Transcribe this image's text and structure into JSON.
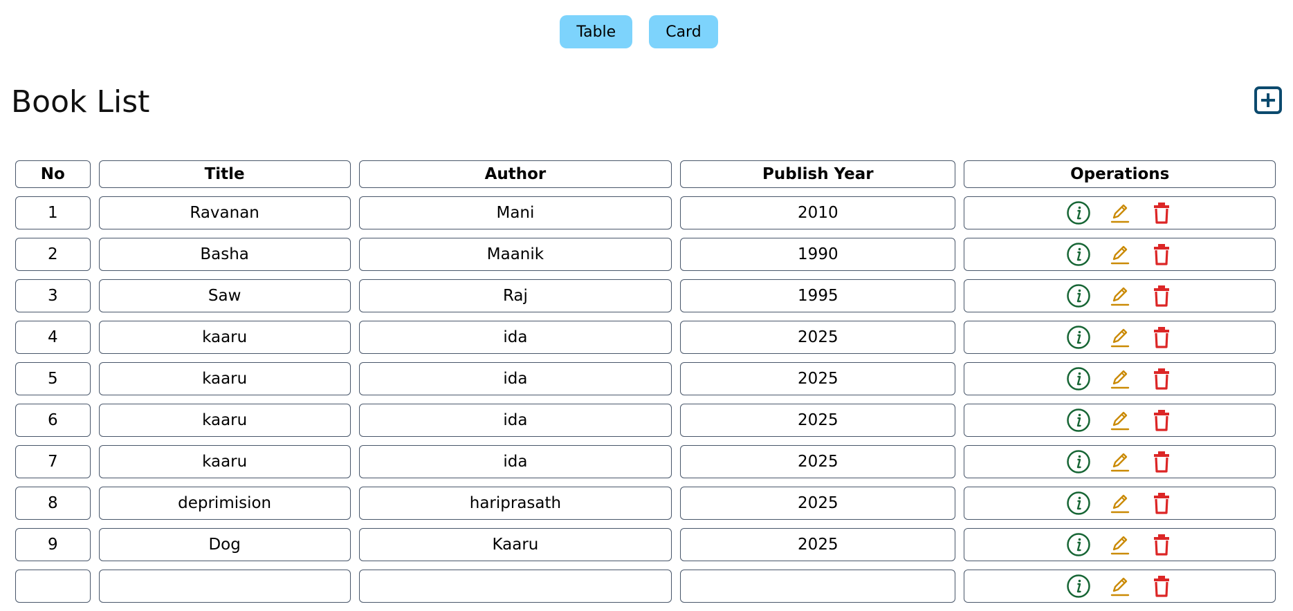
{
  "view_toggle": {
    "table_label": "Table",
    "card_label": "Card"
  },
  "page": {
    "title": "Book List",
    "add_icon": "plus-square-icon"
  },
  "table": {
    "headers": [
      "No",
      "Title",
      "Author",
      "Publish Year",
      "Operations"
    ],
    "rows": [
      {
        "no": "1",
        "title": "Ravanan",
        "author": "Mani",
        "year": "2010"
      },
      {
        "no": "2",
        "title": "Basha",
        "author": "Maanik",
        "year": "1990"
      },
      {
        "no": "3",
        "title": "Saw",
        "author": "Raj",
        "year": "1995"
      },
      {
        "no": "4",
        "title": "kaaru",
        "author": "ida",
        "year": "2025"
      },
      {
        "no": "5",
        "title": "kaaru",
        "author": "ida",
        "year": "2025"
      },
      {
        "no": "6",
        "title": "kaaru",
        "author": "ida",
        "year": "2025"
      },
      {
        "no": "7",
        "title": "kaaru",
        "author": "ida",
        "year": "2025"
      },
      {
        "no": "8",
        "title": "deprimision",
        "author": "hariprasath",
        "year": "2025"
      },
      {
        "no": "9",
        "title": "Dog",
        "author": "Kaaru",
        "year": "2025"
      },
      {
        "no": "",
        "title": "",
        "author": "",
        "year": ""
      }
    ],
    "operations_icons": [
      "info-icon",
      "edit-icon",
      "delete-icon"
    ]
  },
  "colors": {
    "toggle_bg": "#7dd3fc",
    "add_icon": "#0c4a6e",
    "info_icon": "#166534",
    "edit_icon": "#ca8a04",
    "delete_icon": "#dc2626",
    "cell_border": "#475569"
  }
}
